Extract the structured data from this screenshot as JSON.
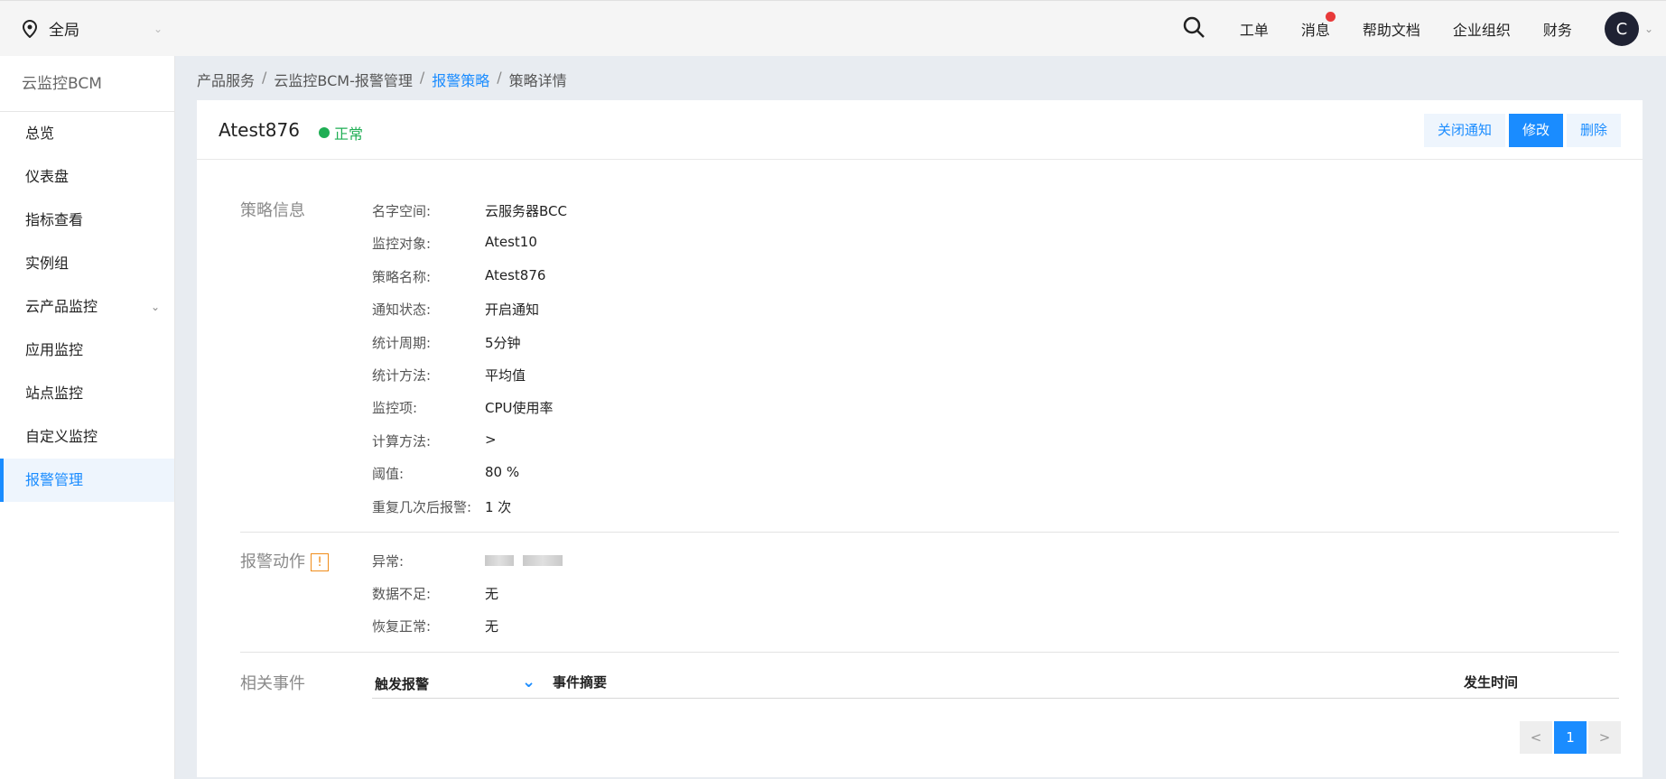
{
  "topbar": {
    "region_label": "全局",
    "nav": [
      "工单",
      "消息",
      "帮助文档",
      "企业组织",
      "财务"
    ],
    "avatar_letter": "C"
  },
  "sidebar": {
    "title": "云监控BCM",
    "items": [
      "总览",
      "仪表盘",
      "指标查看",
      "实例组",
      "云产品监控",
      "应用监控",
      "站点监控",
      "自定义监控",
      "报警管理"
    ],
    "active": "报警管理"
  },
  "breadcrumb": [
    "产品服务",
    "云监控BCM-报警管理",
    "报警策略",
    "策略详情"
  ],
  "policy": {
    "name": "Atest876",
    "status": "正常",
    "buttons": {
      "close_notify": "关闭通知",
      "edit": "修改",
      "delete": "删除"
    }
  },
  "sections": {
    "info_title": "策略信息",
    "action_title": "报警动作",
    "events_title": "相关事件"
  },
  "info": [
    {
      "k": "名字空间:",
      "v": "云服务器BCC"
    },
    {
      "k": "监控对象:",
      "v": "Atest10"
    },
    {
      "k": "策略名称:",
      "v": "Atest876"
    },
    {
      "k": "通知状态:",
      "v": "开启通知"
    },
    {
      "k": "统计周期:",
      "v": "5分钟"
    },
    {
      "k": "统计方法:",
      "v": "平均值"
    },
    {
      "k": "监控项:",
      "v": "CPU使用率"
    },
    {
      "k": "计算方法:",
      "v": ">"
    },
    {
      "k": "阈值:",
      "v": "80 %"
    },
    {
      "k": "重复几次后报警:",
      "v": "1 次"
    }
  ],
  "actions": [
    {
      "k": "异常:",
      "v": ""
    },
    {
      "k": "数据不足:",
      "v": "无"
    },
    {
      "k": "恢复正常:",
      "v": "无"
    }
  ],
  "events": {
    "filter": "触发报警",
    "col_summary": "事件摘要",
    "col_time": "发生时间"
  },
  "pager": {
    "prev": "<",
    "page": "1",
    "next": ">"
  },
  "colors": {
    "accent": "#1a8cff",
    "ok": "#1fae54",
    "warn": "#f08c1a"
  }
}
